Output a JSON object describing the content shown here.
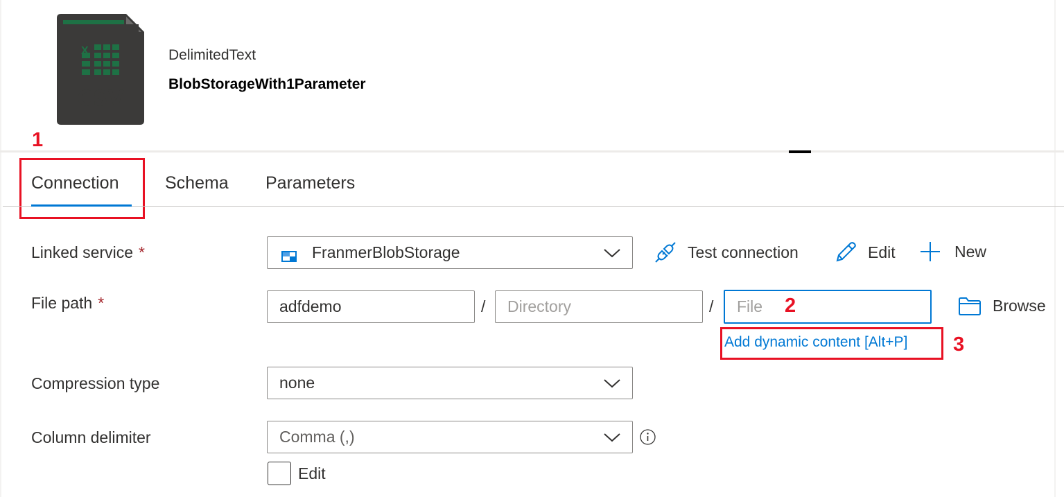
{
  "dataset": {
    "type": "DelimitedText",
    "name": "BlobStorageWith1Parameter",
    "icon": "csv-file-icon",
    "icon_text": "CSV"
  },
  "tabs": [
    {
      "label": "Connection",
      "active": true
    },
    {
      "label": "Schema",
      "active": false
    },
    {
      "label": "Parameters",
      "active": false
    }
  ],
  "annotations": {
    "one": "1",
    "two": "2",
    "three": "3"
  },
  "form": {
    "linked_service": {
      "label": "Linked service",
      "required_mark": "*",
      "value": "FranmerBlobStorage",
      "test_connection": "Test connection",
      "edit": "Edit",
      "new": "New"
    },
    "file_path": {
      "label": "File path",
      "required_mark": "*",
      "container": "adfdemo",
      "directory_placeholder": "Directory",
      "file_placeholder": "File",
      "separator": "/",
      "browse": "Browse",
      "dynamic_content": "Add dynamic content [Alt+P]"
    },
    "compression": {
      "label": "Compression type",
      "value": "none"
    },
    "column_delimiter": {
      "label": "Column delimiter",
      "value": "Comma (,)",
      "edit_checkbox_label": "Edit"
    }
  },
  "colors": {
    "accent": "#0078d4",
    "annotation": "#e81123",
    "excel_green": "#1e7145"
  }
}
